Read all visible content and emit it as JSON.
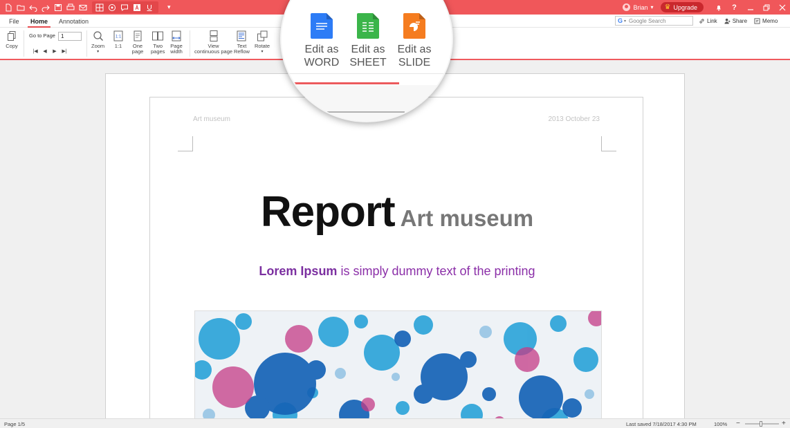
{
  "titlebar": {
    "user_name": "Brian",
    "upgrade_label": "Upgrade"
  },
  "menu": {
    "tabs": [
      "File",
      "Home",
      "Annotation"
    ],
    "active_tab": "Home"
  },
  "search": {
    "placeholder": "Google Search"
  },
  "toplinks": {
    "link": "Link",
    "share": "Share",
    "memo": "Memo"
  },
  "ribbon": {
    "copy": "Copy",
    "go_to_page_label": "Go to Page",
    "page_value": "1",
    "zoom": "Zoom",
    "one_to_one": "1:1",
    "one_page_1": "One",
    "one_page_2": "page",
    "two_pages_1": "Two",
    "two_pages_2": "pages",
    "page_width_1": "Page",
    "page_width_2": "width",
    "view_1": "View",
    "view_2": "continuous page",
    "reflow_1": "Text",
    "reflow_2": "Reflow",
    "rotate": "Rotate"
  },
  "magnifier": {
    "word_1": "Edit as",
    "word_2": "WORD",
    "sheet_1": "Edit as",
    "sheet_2": "SHEET",
    "slide_1": "Edit as",
    "slide_2": "SLIDE",
    "colors": {
      "word": "#2d7cf6",
      "sheet": "#3bb54a",
      "slide": "#f57c1f"
    }
  },
  "document": {
    "header_left": "Art museum",
    "header_right": "2013 October 23",
    "title": "Report",
    "subtitle": "Art museum",
    "lead_bold": "Lorem Ipsum",
    "lead_rest": " is simply dummy text of the printing"
  },
  "status": {
    "page": "Page 1/5",
    "saved": "Last saved 7/18/2017 4:30 PM",
    "zoom": "100%"
  },
  "colors": {
    "accent": "#f0575a",
    "lead_purple": "#8b2fa8"
  }
}
